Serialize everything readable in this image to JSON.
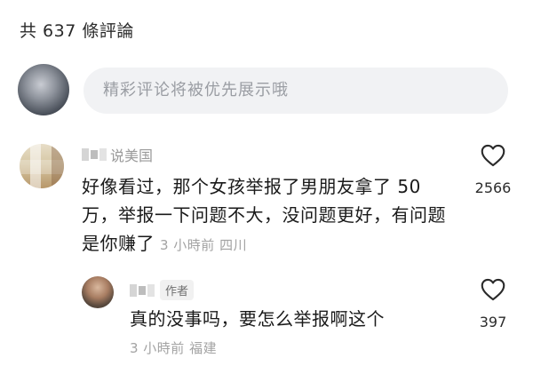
{
  "header": {
    "comment_count_label": "共 637 條評論"
  },
  "composer": {
    "placeholder": "精彩评论将被优先展示哦"
  },
  "comments": [
    {
      "username": "说美国",
      "text": "好像看过，那个女孩举报了男朋友拿了 50 万，举报一下问题不大，没问题更好，有问题是你赚了",
      "time": "3 小時前",
      "location": "四川",
      "likes": "2566",
      "icon": "heart-outline-icon"
    }
  ],
  "replies": [
    {
      "badge": "作者",
      "text": "真的没事吗，要怎么举报啊这个",
      "time": "3 小時前",
      "location": "福建",
      "likes": "397",
      "icon": "heart-outline-icon"
    }
  ]
}
